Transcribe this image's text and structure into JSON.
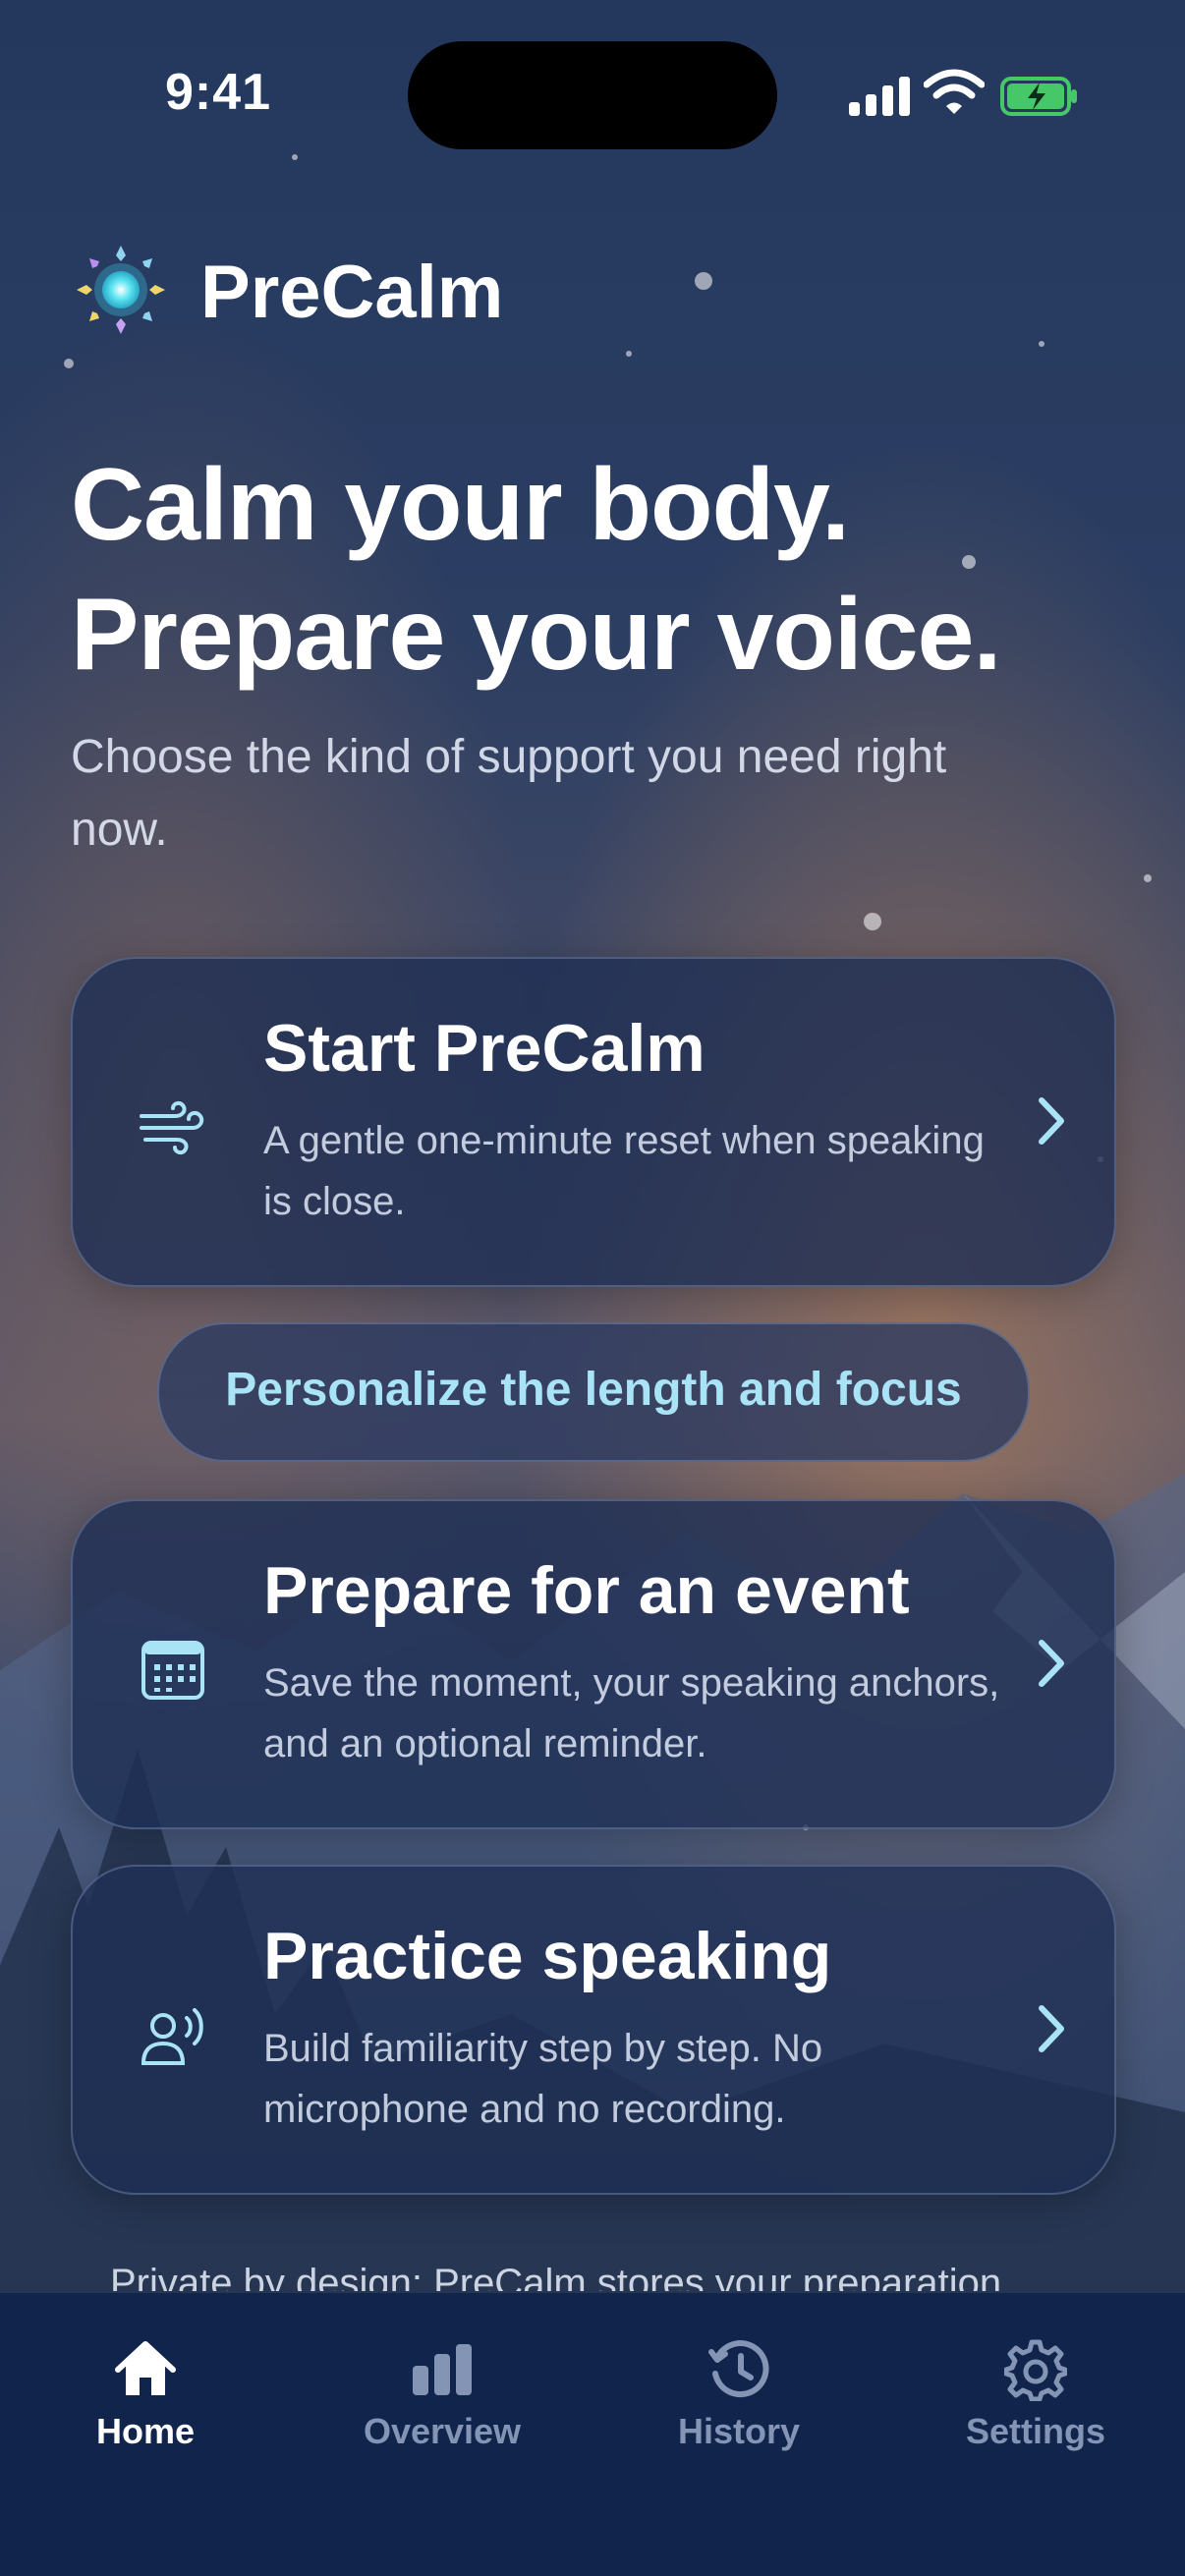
{
  "status_bar": {
    "time": "9:41"
  },
  "app": {
    "name": "PreCalm"
  },
  "hero": {
    "headline_line1": "Calm your body.",
    "headline_line2": "Prepare your voice.",
    "subtext": "Choose the kind of support you need right now."
  },
  "cards": [
    {
      "icon": "wind-icon",
      "title": "Start PreCalm",
      "description": "A gentle one-minute reset when speaking is close."
    },
    {
      "icon": "calendar-icon",
      "title": "Prepare for an event",
      "description": "Save the moment, your speaking anchors, and an optional reminder."
    },
    {
      "icon": "speaking-person-icon",
      "title": "Practice speaking",
      "description": "Build familiarity step by step. No microphone and no recording."
    }
  ],
  "personalize_label": "Personalize the length and focus",
  "privacy_note": "Private by design: PreCalm stores your preparation",
  "tabs": [
    {
      "icon": "home-icon",
      "label": "Home",
      "active": true
    },
    {
      "icon": "bar-chart-icon",
      "label": "Overview",
      "active": false
    },
    {
      "icon": "history-icon",
      "label": "History",
      "active": false
    },
    {
      "icon": "gear-icon",
      "label": "Settings",
      "active": false
    }
  ],
  "colors": {
    "accent": "#a9e3f6",
    "tabbar_bg": "#10244c",
    "card_bg": "#1e2e54",
    "inactive_tab": "#8494b4"
  }
}
